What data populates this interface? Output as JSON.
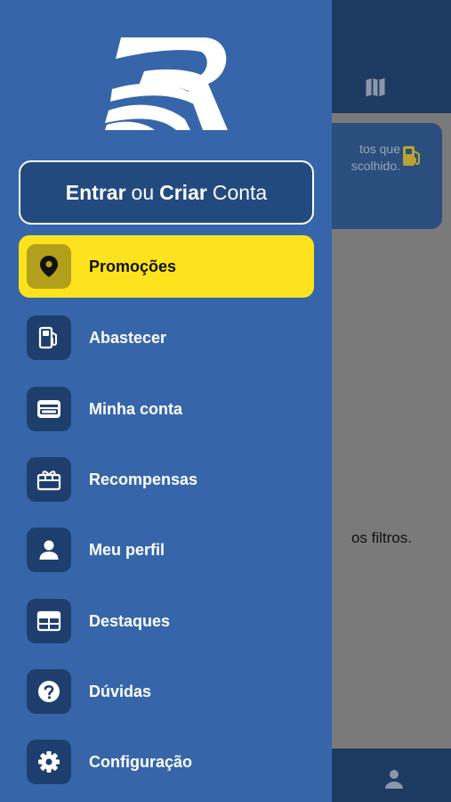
{
  "background": {
    "card_text_line1": "tos que",
    "card_text_line2": "scolhido.",
    "empty_message": "os filtros.",
    "icons": [
      "map-icon",
      "fuel-icon",
      "person-icon"
    ]
  },
  "drawer": {
    "login": {
      "part1": "Entrar",
      "part2": "ou",
      "part3": "Criar",
      "part4": "Conta"
    },
    "menu": [
      {
        "label": "Promoções",
        "icon": "location-pin-icon",
        "active": true
      },
      {
        "label": "Abastecer",
        "icon": "fuel-pump-icon",
        "active": false
      },
      {
        "label": "Minha conta",
        "icon": "wallet-icon",
        "active": false
      },
      {
        "label": "Recompensas",
        "icon": "gift-icon",
        "active": false
      },
      {
        "label": "Meu perfil",
        "icon": "person-icon",
        "active": false
      },
      {
        "label": "Destaques",
        "icon": "table-icon",
        "active": false
      },
      {
        "label": "Dúvidas",
        "icon": "question-icon",
        "active": false
      },
      {
        "label": "Configuração",
        "icon": "gear-icon",
        "active": false
      }
    ]
  },
  "colors": {
    "drawer_bg": "#3666a9",
    "active_item": "#fde21e",
    "icon_box": "#1e3f6d"
  }
}
